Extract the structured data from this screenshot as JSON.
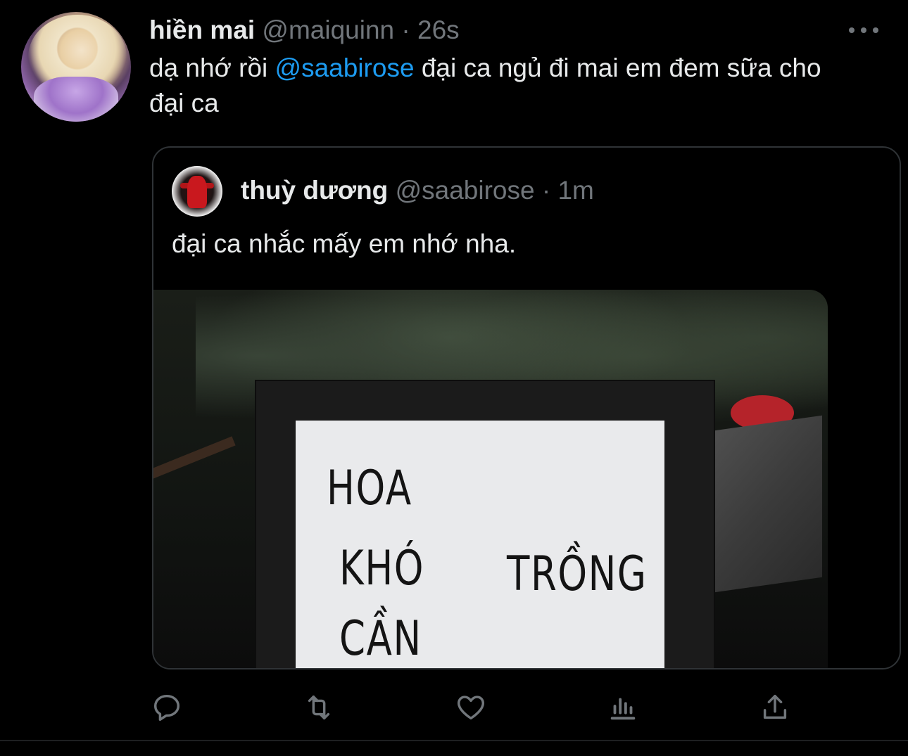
{
  "tweet": {
    "author_name": "hiền mai",
    "handle": "@maiquinn",
    "separator": "·",
    "time": "26s",
    "text_before": "dạ nhớ rồi ",
    "mention": "@saabirose",
    "text_after": " đại ca ngủ đi mai em đem sữa cho đại ca"
  },
  "quote": {
    "author_name": "thuỳ dương",
    "handle": "@saabirose",
    "separator": "·",
    "time": "1m",
    "text": "đại ca nhắc mấy em nhớ nha.",
    "image_sign_lines": [
      "HOA",
      "KHÓ",
      "TRỒNG",
      "CẦN"
    ]
  },
  "icons": {
    "more": "more-horizontal-icon",
    "reply": "reply-icon",
    "retweet": "retweet-icon",
    "like": "heart-icon",
    "analytics": "analytics-icon",
    "share": "share-icon"
  },
  "colors": {
    "background": "#000000",
    "text": "#e7e9ea",
    "muted": "#71767b",
    "link": "#1d9bf0",
    "border": "#2f3336"
  }
}
